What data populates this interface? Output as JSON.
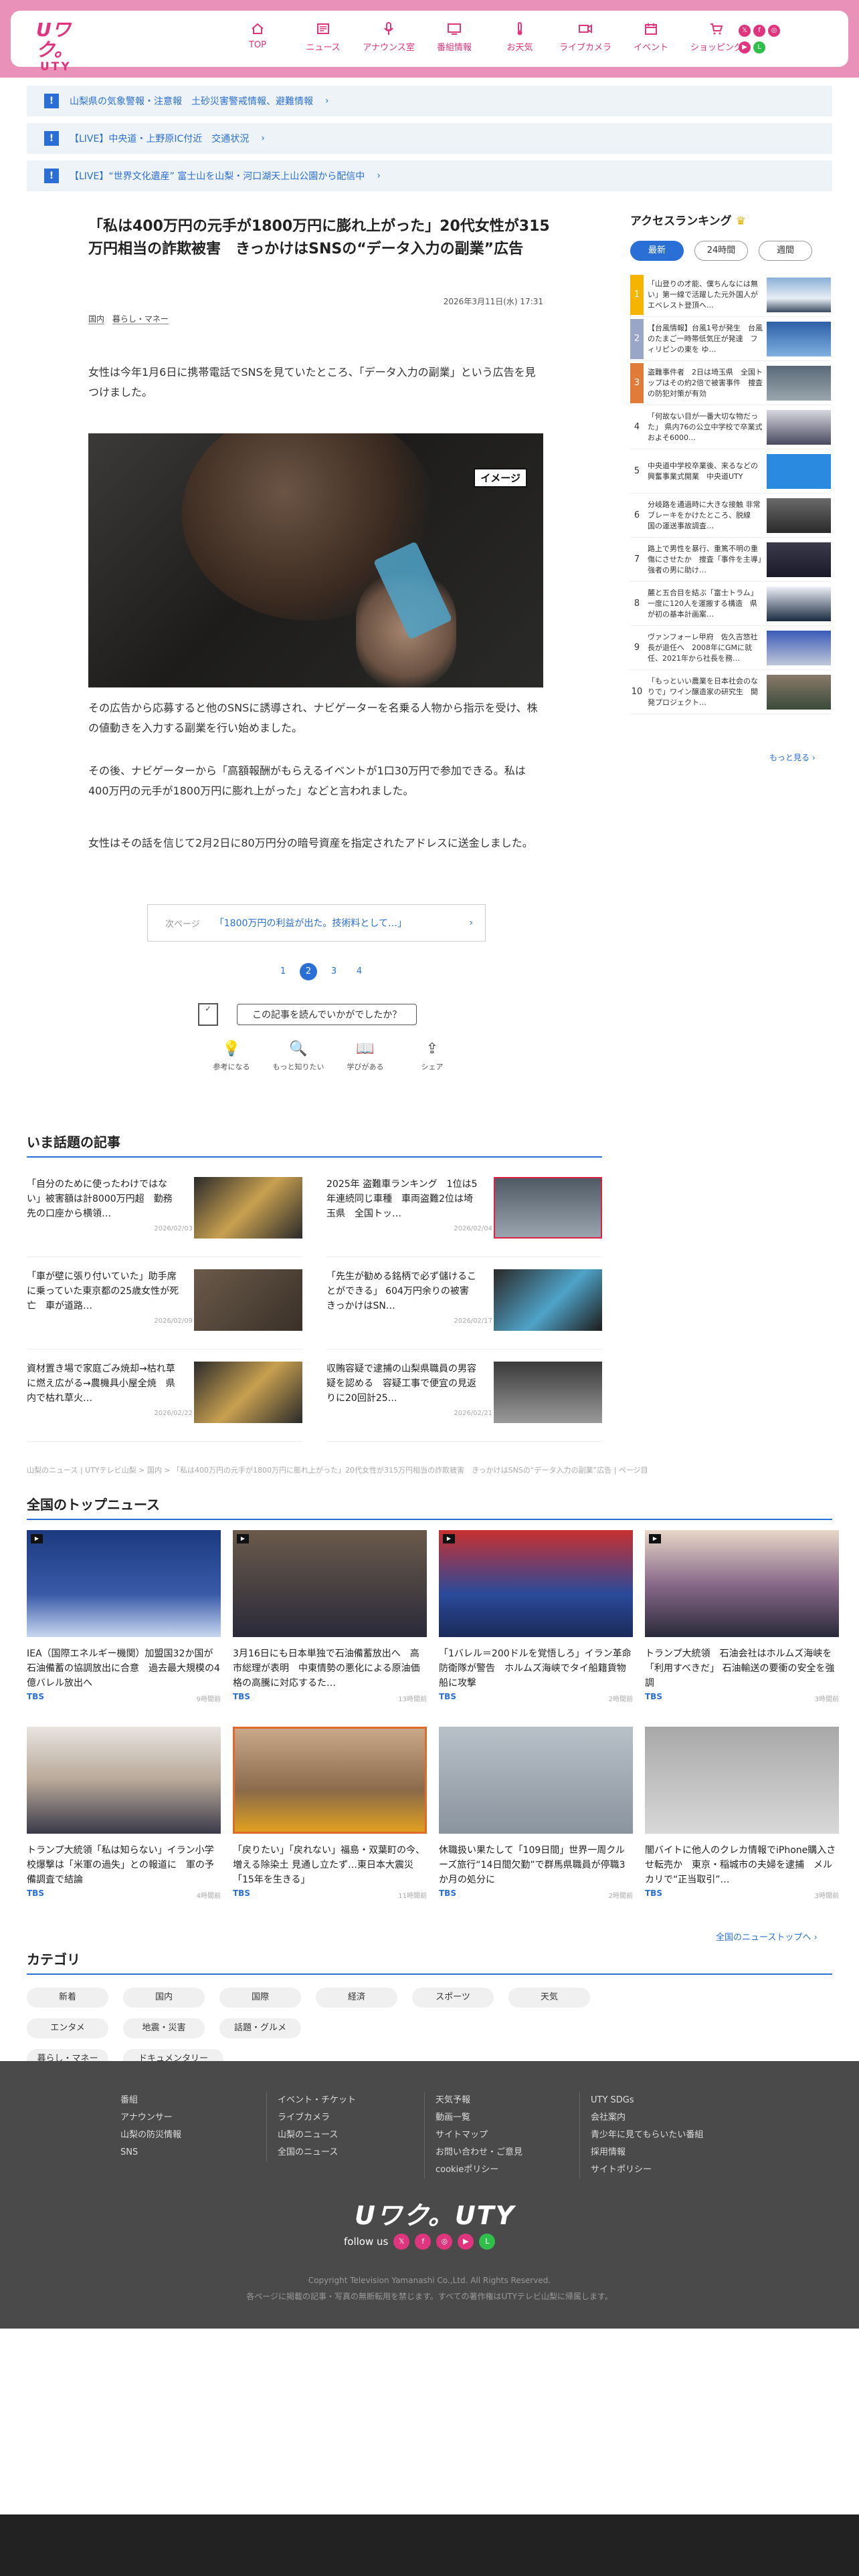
{
  "header": {
    "logo_top": "Uワク。",
    "logo_bottom": "UTY",
    "nav": [
      "TOP",
      "ニュース",
      "アナウンス室",
      "番組情報",
      "お天気",
      "ライブカメラ",
      "イベント",
      "ショッピング"
    ]
  },
  "alerts": [
    "山梨県の気象警報・注意報　土砂災害警戒情報、避難情報",
    "【LIVE】中央道・上野原IC付近　交通状況",
    "【LIVE】“世界文化遺産” 富士山を山梨・河口湖天上山公園から配信中"
  ],
  "article": {
    "title": "「私は400万円の元手が1800万円に膨れ上がった」20代女性が315万円相当の詐欺被害　きっかけはSNSの“データ入力の副業”広告",
    "date": "2026年3月11日(水) 17:31",
    "tags": [
      "国内",
      "暮らし・マネー"
    ],
    "para1": "女性は今年1月6日に携帯電話でSNSを見ていたところ、「データ入力の副業」という広告を見つけました。",
    "photo_label": "イメージ",
    "para2": "その広告から応募すると他のSNSに誘導され、ナビゲーターを名乗る人物から指示を受け、株の値動きを入力する副業を行い始めました。",
    "para3": "その後、ナビゲーターから「高額報酬がもらえるイベントが1口30万円で参加できる。私は400万円の元手が1800万円に膨れ上がった」などと言われました。",
    "para4": "女性はその話を信じて2月2日に80万円分の暗号資産を指定されたアドレスに送金しました。",
    "next_label": "次ページ",
    "next_title": "「1800万円の利益が出た。技術料として…」",
    "pages": [
      "1",
      "2",
      "3",
      "4"
    ],
    "survey": "この記事を読んでいかがでしたか？",
    "reactions": [
      "参考になる",
      "もっと知りたい",
      "学びがある",
      "シェア"
    ]
  },
  "ranking": {
    "title": "アクセスランキング",
    "tabs": [
      "最新",
      "24時間",
      "週間"
    ],
    "items": [
      "「山登りの才能、僕ちんなには無い」第一線で活躍した元外国人がエベレスト登頂へ…",
      "【台風情報】台風1号が発生　台風のたまご一時帯低気圧が発達　フィリピンの東を ゆ…",
      "盗難事件者　2日は埼玉県　全国トップはその約2倍で被害事件　捜査の防犯対策が有効",
      "「何故ない目が一番大切な物だった」 県内76の公立中学校で卒業式　およそ6000…",
      "中央道中学校卒業後、来るなどの興奮事業式開業　中央道UTY",
      "分岐路を通過時に大きな接触 非常ブレーキをかけたところ、脱線　国の運送事故調査…",
      "路上で男性を暴行、重篤不明の重傷にさせたか　捜査「事件を主導」強者の男に助け…",
      "麓と五合目を結ぶ「富士トラム」　一度に120人を運搬する構造　県が初の基本計画案…",
      "ヴァンフォーレ甲府　佐久吉悠社長が退任へ　2008年にGMに就任、2021年から社長を務…",
      "「もっといい農業を日本社会のなりで」ワイン醸造家の研究生　開発プロジェクト…"
    ],
    "more": "もっと見る"
  },
  "hot": {
    "title": "いま話題の記事",
    "items": [
      {
        "title": "「自分のために使ったわけではない」被害額は計8000万円超　勤務先の口座から横領…",
        "date": "2026/02/03"
      },
      {
        "title": "2025年 盗難車ランキング　1位は5年連続同じ車種　車両盗難2位は埼玉県　全国トッ…",
        "date": "2026/02/04"
      },
      {
        "title": "「車が壁に張り付いていた」助手席に乗っていた東京都の25歳女性が死亡　車が道路…",
        "date": "2026/02/09"
      },
      {
        "title": "「先生が勧める銘柄で必ず儲けることができる」 604万円余りの被害　きっかけはSN…",
        "date": "2026/02/17"
      },
      {
        "title": "資材置き場で家庭ごみ焼却→枯れ草に燃え広がる→農機具小屋全焼　県内で枯れ草火…",
        "date": "2026/02/22"
      },
      {
        "title": "収賄容疑で逮捕の山梨県職員の男容疑を認める　容疑工事で便宜の見返りに20回計25…",
        "date": "2026/02/21"
      }
    ]
  },
  "breadcrumb": "山梨のニュース | UTYテレビ山梨 > 国内 > 「私は400万円の元手が1800万円に膨れ上がった」20代女性が315万円相当の詐欺被害　きっかけはSNSの“データ入力の副業”広告 | ページ目",
  "national": {
    "title": "全国のトップニュース",
    "items": [
      {
        "title": "IEA（国際エネルギー機関）加盟国32か国が石油備蓄の協調放出に合意　過去最大規模の4億バレル放出へ",
        "src": "TBS",
        "date": "9時間前"
      },
      {
        "title": "3月16日にも日本単独で石油備蓄放出へ　高市総理が表明　中東情勢の悪化による原油価格の高騰に対応するた…",
        "src": "TBS",
        "date": "13時間前"
      },
      {
        "title": "「1バレル＝200ドルを覚悟しろ」イラン革命防衛隊が警告　ホルムズ海峡でタイ船籍貨物船に攻撃",
        "src": "TBS",
        "date": "2時間前"
      },
      {
        "title": "トランプ大統領　石油会社はホルムズ海峡を「利用すべきだ」 石油輸送の要衝の安全を強調",
        "src": "TBS",
        "date": "3時間前"
      },
      {
        "title": "トランプ大統領「私は知らない」イラン小学校爆撃は「米軍の過失」との報道に　軍の予備調査で結論",
        "src": "TBS",
        "date": "4時間前"
      },
      {
        "title": "「戻りたい」「戻れない」福島・双葉町の今、増える除染土 見通し立たず…東日本大震災「15年を生きる」",
        "src": "TBS",
        "date": "11時間前"
      },
      {
        "title": "休職扱い果たして「109日間」世界一周クルーズ旅行“14日間欠勤”で群馬県職員が停職3か月の処分に",
        "src": "TBS",
        "date": "2時間前"
      },
      {
        "title": "闇バイトに他人のクレカ情報でiPhone購入させ転売か　東京・稲城市の夫婦を逮捕　メルカリで“正当取引”…",
        "src": "TBS",
        "date": "3時間前"
      }
    ],
    "more": "全国のニューストップへ"
  },
  "categories": {
    "title": "カテゴリ",
    "items": [
      "新着",
      "国内",
      "国際",
      "経済",
      "スポーツ",
      "天気",
      "エンタメ",
      "地震・災害",
      "話題・グルメ",
      "暮らし・マネー",
      "ドキュメンタリー"
    ]
  },
  "footer": {
    "col1": [
      "番組",
      "アナウンサー",
      "山梨の防災情報",
      "SNS"
    ],
    "col2": [
      "イベント・チケット",
      "ライブカメラ",
      "山梨のニュース",
      "全国のニュース"
    ],
    "col3": [
      "天気予報",
      "動画一覧",
      "サイトマップ",
      "お問い合わせ・ご意見",
      "cookieポリシー"
    ],
    "col4": [
      "UTY SDGs",
      "会社案内",
      "青少年に見てもらいたい番組",
      "採用情報",
      "サイトポリシー"
    ],
    "logo": "Uワク。UTY",
    "follow": "follow us",
    "copyright": "Copyright Television Yamanashi Co.,Ltd. All Rights Reserved.",
    "notice": "各ページに掲載の記事・写真の無断転用を禁じます。すべての著作権はUTYテレビ山梨に帰属します。"
  }
}
